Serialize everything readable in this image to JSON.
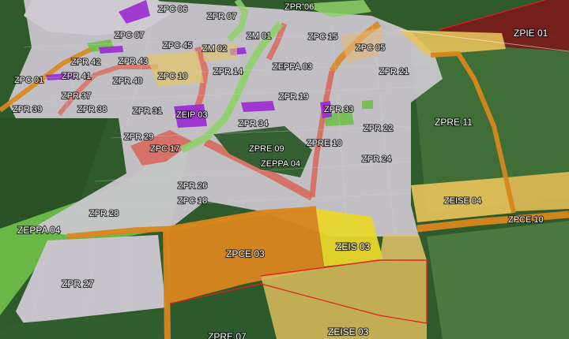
{
  "map": {
    "colors": {
      "pasture": "#2f5a2c",
      "pasture_light": "#4d7a3e",
      "urban": "#c9c5cc",
      "zpc_orange": "#d9861e",
      "zpr_gray": "#bdbac2",
      "zeise_yellow": "#e6c25a",
      "zeis_yellow": "#e8d62a",
      "zpie_red": "#7a1a1a",
      "zeip_purple": "#9a2ad0",
      "zeppa_green": "#6fbf4a",
      "salmon": "#d86a5e",
      "outline_red": "#e02020"
    },
    "labels": [
      "ZPC 06",
      "ZPR 07",
      "ZPR 06",
      "ZPC 07",
      "ZPC 45",
      "ZM 01",
      "ZPC 15",
      "ZPIE 01",
      "ZPR 42",
      "ZPR 43",
      "ZM 02",
      "ZPC 05",
      "ZPC 01",
      "ZPR 41",
      "ZPR 40",
      "ZPC 10",
      "ZPR 14",
      "ZEPPA 03",
      "ZPR 21",
      "ZPR 37",
      "ZPR 19",
      "ZPR 39",
      "ZPR 38",
      "ZPR 31",
      "ZEIP 03",
      "ZPR 33",
      "ZPRE 11",
      "ZPR 34",
      "ZPR 22",
      "ZPR 29",
      "ZPRE 10",
      "ZPC 17",
      "ZPRE 09",
      "ZPR 24",
      "ZEPPA 04",
      "ZPR 26",
      "ZPC 18",
      "ZEISE 04",
      "ZPR 28",
      "ZPCE 10",
      "ZEPPA 04",
      "ZPCE 03",
      "ZEIS 03",
      "ZPR 27",
      "ZEISE 03",
      "ZPRE 07"
    ]
  }
}
